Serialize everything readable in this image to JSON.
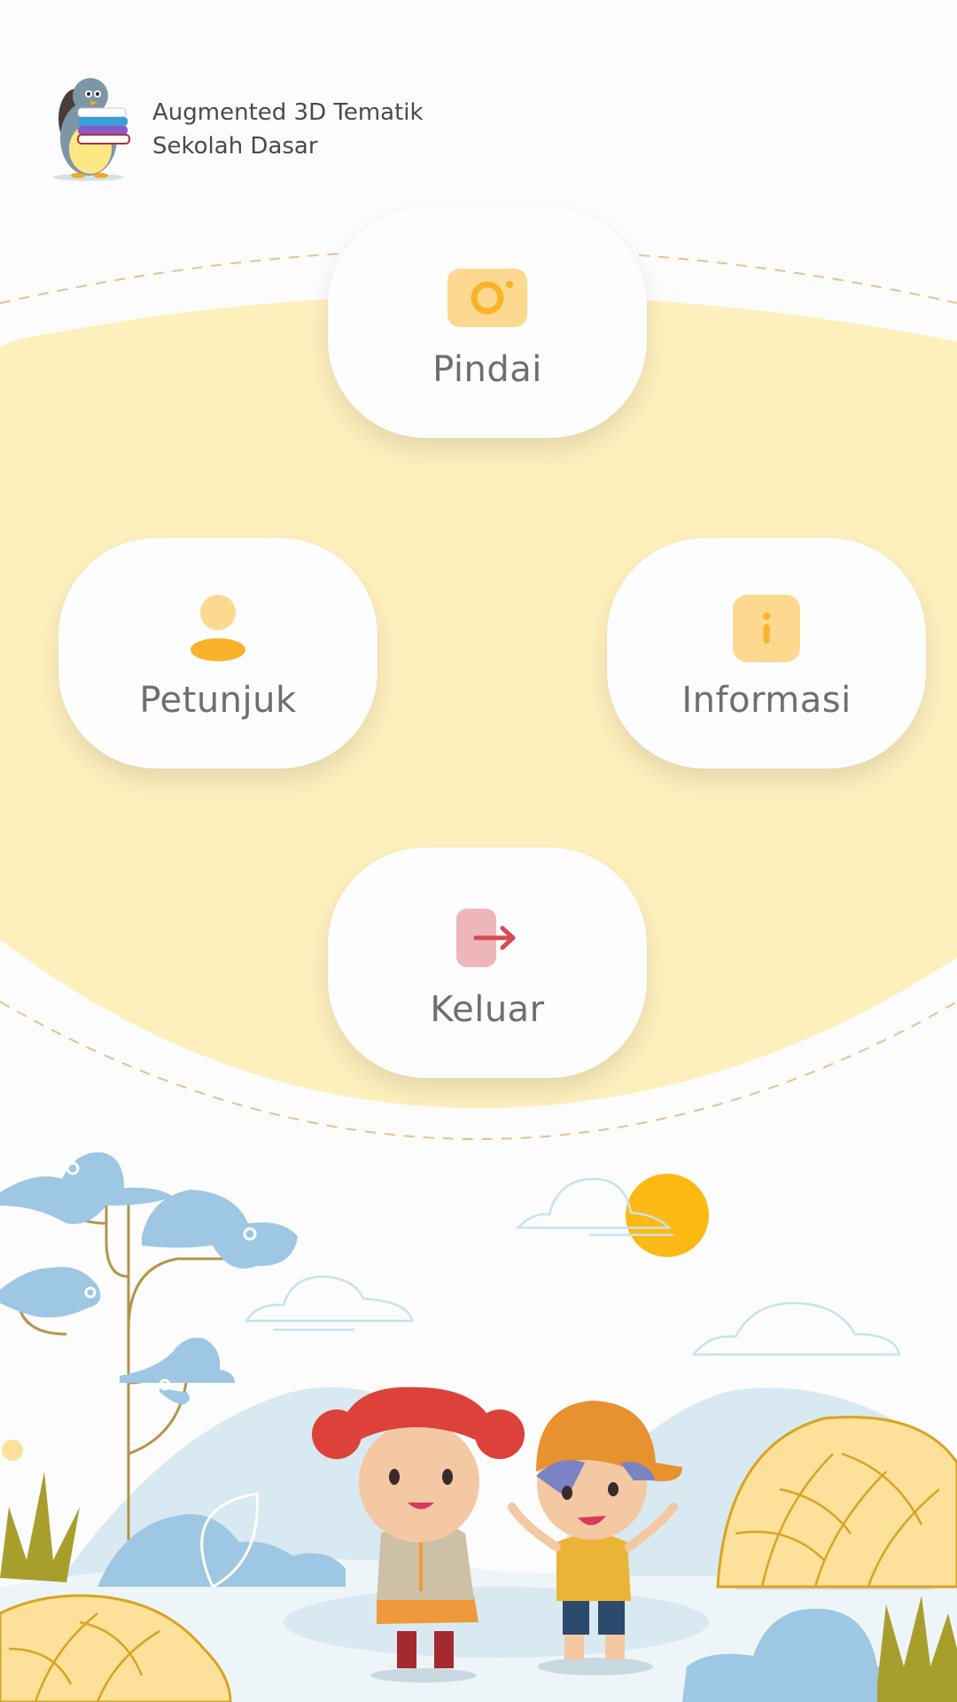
{
  "header": {
    "title_line1": "Augmented 3D Tematik",
    "title_line2": "Sekolah Dasar",
    "logo_icon": "penguin-with-books-icon"
  },
  "menu": {
    "scan": {
      "label": "Pindai",
      "icon": "camera-icon"
    },
    "help": {
      "label": "Petunjuk",
      "icon": "user-icon"
    },
    "info": {
      "label": "Informasi",
      "icon": "info-icon"
    },
    "exit": {
      "label": "Keluar",
      "icon": "exit-icon"
    }
  },
  "colors": {
    "background": "#fcfcfc",
    "arc_fill": "#fef0bd",
    "dash_line": "#e8c08f",
    "accent_yellow": "#fbb22b",
    "light_yellow": "#fcd98f",
    "exit_red": "#d74a55",
    "exit_pink": "#eeb5bb",
    "label_gray": "#6e6e6e"
  }
}
